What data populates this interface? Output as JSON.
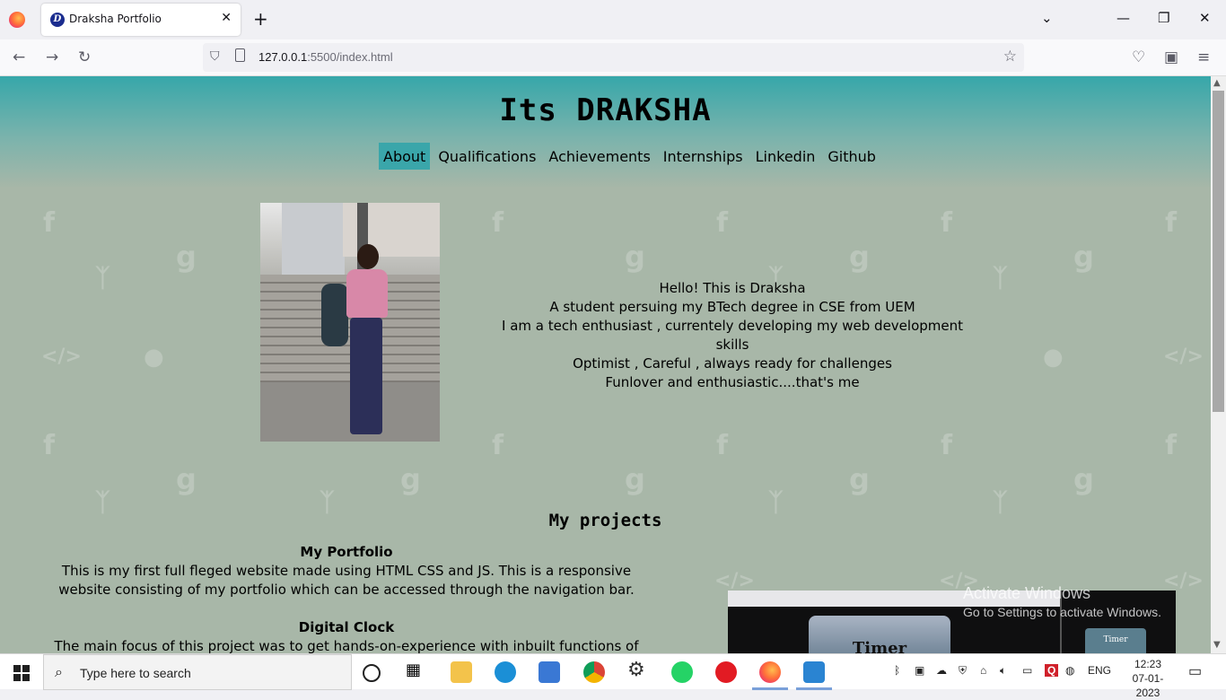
{
  "browser": {
    "tab_title": "Draksha Portfolio",
    "tab_favicon_letter": "D",
    "url_host": "127.0.0.1",
    "url_rest": ":5500/index.html"
  },
  "site": {
    "title": "Its DRAKSHA",
    "nav": [
      {
        "label": "About",
        "active": true
      },
      {
        "label": "Qualifications",
        "active": false
      },
      {
        "label": "Achievements",
        "active": false
      },
      {
        "label": "Internships",
        "active": false
      },
      {
        "label": "Linkedin",
        "active": false
      },
      {
        "label": "Github",
        "active": false
      }
    ],
    "about_lines": [
      "Hello! This is Draksha",
      "A student persuing my BTech degree in CSE from UEM",
      "I am a tech enthusiast , currentely developing my web development skills",
      "Optimist , Careful , always ready for challenges",
      "Funlover and enthusiastic....that's me"
    ],
    "projects_heading": "My projects",
    "projects": [
      {
        "title": "My Portfolio",
        "desc": "This is my first full fleged website made using HTML CSS and JS. This is a responsive website consisting of my portfolio which can be accessed through the navigation bar."
      },
      {
        "title": "Digital Clock",
        "desc": "The main focus of this project was to get hands-on-experience with inbuilt functions of"
      }
    ],
    "preview_timer_label": "Timer",
    "preview_timer_small": "Timer"
  },
  "watermark": {
    "line1": "Activate Windows",
    "line2": "Go to Settings to activate Windows."
  },
  "taskbar": {
    "search_placeholder": "Type here to search",
    "lang": "ENG",
    "time": "12:23",
    "date": "07-01-2023"
  }
}
